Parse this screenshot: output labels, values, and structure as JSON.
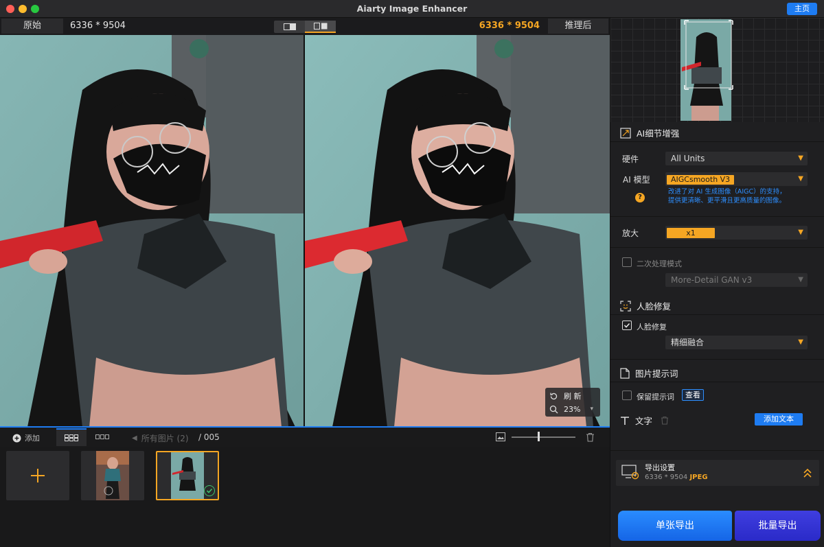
{
  "window": {
    "title": "Aiarty Image Enhancer",
    "home_label": "主页"
  },
  "compare": {
    "original_label": "原始",
    "original_size": "6336 * 9504",
    "processed_size": "6336 * 9504",
    "processed_label": "推理后"
  },
  "zoom": {
    "refresh_label": "刷 新",
    "level": "23%"
  },
  "gallery": {
    "add_label": "添加",
    "all_images_label": "所有图片 (2)",
    "count": "/ 005"
  },
  "panel": {
    "detail": {
      "title": "AI细节增强",
      "hardware_label": "硬件",
      "hardware_value": "All Units",
      "model_label": "AI 模型",
      "model_value": "AIGCsmooth  V3",
      "model_desc_1": "改进了对 AI 生成图像（AIGC）的支持，",
      "model_desc_2": "提供更清晰、更平滑且更高质量的图像。",
      "scale_label": "放大",
      "scale_value": "x1",
      "second_pass_label": "二次处理模式",
      "second_pass_value": "More-Detail GAN v3"
    },
    "face": {
      "title": "人脸修复",
      "checkbox_label": "人脸修复",
      "mode_value": "精细融合"
    },
    "prompt": {
      "title": "图片提示词",
      "keep_label": "保留提示词",
      "view_label": "查看"
    },
    "text": {
      "title": "文字",
      "add_label": "添加文本"
    },
    "export": {
      "title": "导出设置",
      "size": "6336 * 9504",
      "format": "JPEG",
      "single_label": "单张导出",
      "batch_label": "批量导出"
    }
  },
  "colors": {
    "accent_orange": "#f5a623",
    "accent_blue": "#1e7cf2",
    "batch_purple": "#2f2fd0"
  }
}
